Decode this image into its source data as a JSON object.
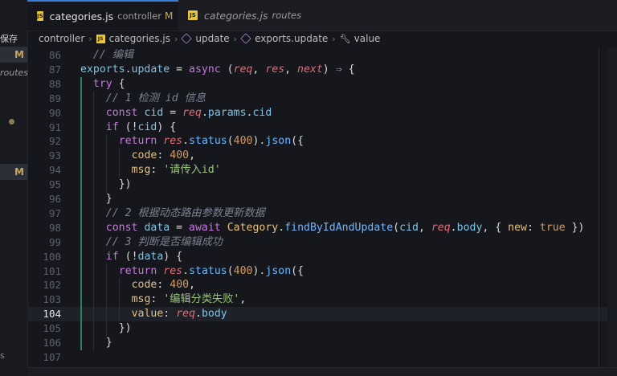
{
  "sidebar": {
    "label_top": "保存",
    "badge_1": "M",
    "label_routes": "routes",
    "badge_2": "M",
    "label_bottom": "s"
  },
  "tabs": [
    {
      "name": "categories.js",
      "sub": "controller",
      "mod": "M",
      "active": true
    },
    {
      "name": "categories.js",
      "sub": "routes",
      "active": false
    }
  ],
  "breadcrumb": {
    "items": [
      "controller",
      "categories.js",
      "update",
      "exports.update",
      "value"
    ]
  },
  "editor": {
    "current_line": "104",
    "lines": [
      {
        "n": "86",
        "indent": 1,
        "tokens": [
          [
            "c-com",
            "// 编辑"
          ]
        ]
      },
      {
        "n": "87",
        "indent": 0,
        "tokens": [
          [
            "c-var",
            "exports"
          ],
          [
            "c-pl",
            "."
          ],
          [
            "c-var",
            "update"
          ],
          [
            "c-pl",
            " = "
          ],
          [
            "c-kw",
            "async"
          ],
          [
            "c-pl",
            " ("
          ],
          [
            "c-par",
            "req"
          ],
          [
            "c-pl",
            ", "
          ],
          [
            "c-par",
            "res"
          ],
          [
            "c-pl",
            ", "
          ],
          [
            "c-par",
            "next"
          ],
          [
            "c-pl",
            ") "
          ],
          [
            "c-kw",
            "⇒"
          ],
          [
            "c-pl",
            " {"
          ]
        ]
      },
      {
        "n": "88",
        "indent": 1,
        "tokens": [
          [
            "c-kw",
            "try"
          ],
          [
            "c-pl",
            " {"
          ]
        ]
      },
      {
        "n": "89",
        "indent": 2,
        "tokens": [
          [
            "c-com",
            "// 1 检测 id 信息"
          ]
        ]
      },
      {
        "n": "90",
        "indent": 2,
        "tokens": [
          [
            "c-kw",
            "const"
          ],
          [
            "c-pl",
            " "
          ],
          [
            "c-var",
            "cid"
          ],
          [
            "c-pl",
            " = "
          ],
          [
            "c-par",
            "req"
          ],
          [
            "c-pl",
            "."
          ],
          [
            "c-var",
            "params"
          ],
          [
            "c-pl",
            "."
          ],
          [
            "c-var",
            "cid"
          ]
        ]
      },
      {
        "n": "91",
        "indent": 2,
        "tokens": [
          [
            "c-kw",
            "if"
          ],
          [
            "c-pl",
            " (!"
          ],
          [
            "c-var",
            "cid"
          ],
          [
            "c-pl",
            ") {"
          ]
        ]
      },
      {
        "n": "92",
        "indent": 3,
        "tokens": [
          [
            "c-kw",
            "return"
          ],
          [
            "c-pl",
            " "
          ],
          [
            "c-par",
            "res"
          ],
          [
            "c-pl",
            "."
          ],
          [
            "c-fn",
            "status"
          ],
          [
            "c-pl",
            "("
          ],
          [
            "c-num",
            "400"
          ],
          [
            "c-pl",
            ")."
          ],
          [
            "c-fn",
            "json"
          ],
          [
            "c-pl",
            "({"
          ]
        ]
      },
      {
        "n": "93",
        "indent": 4,
        "tokens": [
          [
            "c-prop",
            "code"
          ],
          [
            "c-pl",
            ": "
          ],
          [
            "c-num",
            "400"
          ],
          [
            "c-pl",
            ","
          ]
        ]
      },
      {
        "n": "94",
        "indent": 4,
        "tokens": [
          [
            "c-prop",
            "msg"
          ],
          [
            "c-pl",
            ": "
          ],
          [
            "c-str",
            "'请传入id'"
          ]
        ]
      },
      {
        "n": "95",
        "indent": 3,
        "tokens": [
          [
            "c-pl",
            "})"
          ]
        ]
      },
      {
        "n": "96",
        "indent": 2,
        "tokens": [
          [
            "c-pl",
            "}"
          ]
        ]
      },
      {
        "n": "97",
        "indent": 2,
        "tokens": [
          [
            "c-com",
            "// 2 根据动态路由参数更新数据"
          ]
        ]
      },
      {
        "n": "98",
        "indent": 2,
        "tokens": [
          [
            "c-kw",
            "const"
          ],
          [
            "c-pl",
            " "
          ],
          [
            "c-var",
            "data"
          ],
          [
            "c-pl",
            " = "
          ],
          [
            "c-kw",
            "await"
          ],
          [
            "c-pl",
            " "
          ],
          [
            "c-cls",
            "Category"
          ],
          [
            "c-pl",
            "."
          ],
          [
            "c-fn",
            "findByIdAndUpdate"
          ],
          [
            "c-pl",
            "("
          ],
          [
            "c-var",
            "cid"
          ],
          [
            "c-pl",
            ", "
          ],
          [
            "c-par",
            "req"
          ],
          [
            "c-pl",
            "."
          ],
          [
            "c-var",
            "body"
          ],
          [
            "c-pl",
            ", { "
          ],
          [
            "c-prop",
            "new"
          ],
          [
            "c-pl",
            ": "
          ],
          [
            "c-bool",
            "true"
          ],
          [
            "c-pl",
            " })"
          ]
        ]
      },
      {
        "n": "99",
        "indent": 2,
        "tokens": [
          [
            "c-com",
            "// 3 判断是否编辑成功"
          ]
        ]
      },
      {
        "n": "100",
        "indent": 2,
        "tokens": [
          [
            "c-kw",
            "if"
          ],
          [
            "c-pl",
            " (!"
          ],
          [
            "c-var",
            "data"
          ],
          [
            "c-pl",
            ") {"
          ]
        ]
      },
      {
        "n": "101",
        "indent": 3,
        "tokens": [
          [
            "c-kw",
            "return"
          ],
          [
            "c-pl",
            " "
          ],
          [
            "c-par",
            "res"
          ],
          [
            "c-pl",
            "."
          ],
          [
            "c-fn",
            "status"
          ],
          [
            "c-pl",
            "("
          ],
          [
            "c-num",
            "400"
          ],
          [
            "c-pl",
            ")."
          ],
          [
            "c-fn",
            "json"
          ],
          [
            "c-pl",
            "({"
          ]
        ]
      },
      {
        "n": "102",
        "indent": 4,
        "tokens": [
          [
            "c-prop",
            "code"
          ],
          [
            "c-pl",
            ": "
          ],
          [
            "c-num",
            "400"
          ],
          [
            "c-pl",
            ","
          ]
        ]
      },
      {
        "n": "103",
        "indent": 4,
        "tokens": [
          [
            "c-prop",
            "msg"
          ],
          [
            "c-pl",
            ": "
          ],
          [
            "c-str",
            "'编辑分类失败'"
          ],
          [
            "c-pl",
            ","
          ]
        ]
      },
      {
        "n": "104",
        "indent": 4,
        "tokens": [
          [
            "c-prop",
            "value"
          ],
          [
            "c-pl",
            ": "
          ],
          [
            "c-par",
            "req"
          ],
          [
            "c-pl",
            "."
          ],
          [
            "c-var",
            "body"
          ]
        ]
      },
      {
        "n": "105",
        "indent": 3,
        "tokens": [
          [
            "c-pl",
            "})"
          ]
        ]
      },
      {
        "n": "106",
        "indent": 2,
        "tokens": [
          [
            "c-pl",
            "}"
          ]
        ]
      },
      {
        "n": "107",
        "indent": 0,
        "tokens": []
      }
    ]
  }
}
